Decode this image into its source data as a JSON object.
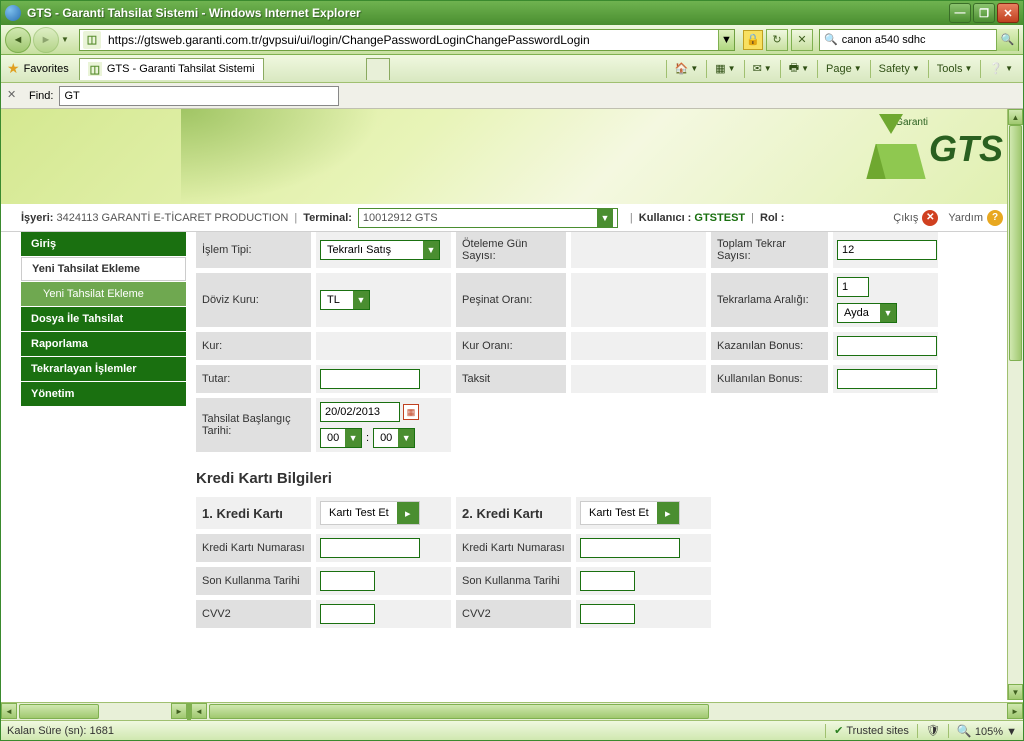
{
  "window": {
    "title": "GTS - Garanti Tahsilat Sistemi - Windows Internet Explorer"
  },
  "nav": {
    "url": "https://gtsweb.garanti.com.tr/gvpsui/ui/login/ChangePasswordLoginChangePasswordLogin",
    "search": "canon a540 sdhc"
  },
  "favbar": {
    "favorites": "Favorites",
    "tab": "GTS - Garanti Tahsilat Sistemi"
  },
  "toolbar": {
    "page": "Page",
    "safety": "Safety",
    "tools": "Tools"
  },
  "find": {
    "label": "Find:",
    "value": "GT"
  },
  "logo": {
    "brand": "Garanti",
    "name": "GTS"
  },
  "infobar": {
    "isyeri_l": "İşyeri:",
    "isyeri_v": "3424113 GARANTİ E-TİCARET PRODUCTION",
    "terminal_l": "Terminal:",
    "terminal_v": "10012912 GTS",
    "kullanici_l": "Kullanıcı :",
    "kullanici_v": "GTSTEST",
    "rol_l": "Rol :",
    "cikis": "Çıkış",
    "yardim": "Yardım"
  },
  "sidebar": {
    "items": [
      "Giriş",
      "Yeni Tahsilat Ekleme",
      "Yeni Tahsilat Ekleme",
      "Dosya İle Tahsilat",
      "Raporlama",
      "Tekrarlayan İşlemler",
      "Yönetim"
    ]
  },
  "form": {
    "islem_tipi_l": "İşlem Tipi:",
    "islem_tipi_v": "Tekrarlı Satış",
    "oteleme_l": "Öteleme Gün Sayısı:",
    "toplam_tekrar_l": "Toplam Tekrar Sayısı:",
    "toplam_tekrar_v": "12",
    "doviz_l": "Döviz Kuru:",
    "doviz_v": "TL",
    "pesinat_l": "Peşinat Oranı:",
    "tekrarlama_l": "Tekrarlama Aralığı:",
    "tekrarlama_n": "1",
    "tekrarlama_u": "Ayda",
    "kur_l": "Kur:",
    "kur_orani_l": "Kur Oranı:",
    "kazanilan_l": "Kazanılan Bonus:",
    "tutar_l": "Tutar:",
    "taksit_l": "Taksit",
    "kullanilan_l": "Kullanılan Bonus:",
    "tarih_l": "Tahsilat Başlangıç Tarihi:",
    "tarih_v": "20/02/2013",
    "saat_h": "00",
    "saat_m": "00"
  },
  "cards": {
    "section": "Kredi Kartı Bilgileri",
    "h1": "1. Kredi Kartı",
    "h2": "2. Kredi Kartı",
    "test": "Kartı Test Et",
    "num_l": "Kredi Kartı Numarası",
    "exp_l": "Son Kullanma Tarihi",
    "cvv_l": "CVV2"
  },
  "status": {
    "kalan": "Kalan Süre (sn): 1681",
    "trusted": "Trusted sites",
    "zoom": "105%"
  }
}
